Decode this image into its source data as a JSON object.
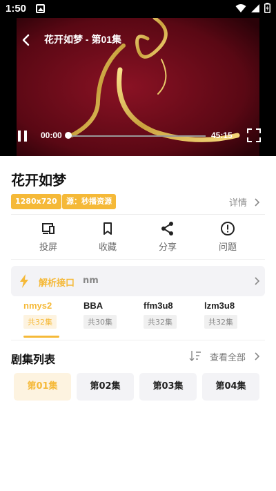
{
  "status_bar": {
    "time": "1:50",
    "icons": [
      "image-icon",
      "wifi-icon",
      "signal-icon",
      "battery-charging-icon"
    ]
  },
  "player": {
    "title": "花开如梦 - 第01集",
    "current_time": "00:00",
    "total_time": "45:15",
    "progress": 0,
    "state": "playing"
  },
  "info": {
    "title": "花开如梦",
    "badges": [
      "1280x720",
      "源：秒播资源"
    ],
    "details_label": "详情"
  },
  "actions": [
    {
      "label": "投屏",
      "icon": "cast-icon"
    },
    {
      "label": "收藏",
      "icon": "bookmark-icon"
    },
    {
      "label": "分享",
      "icon": "share-icon"
    },
    {
      "label": "问题",
      "icon": "alert-icon"
    }
  ],
  "source": {
    "label": "解析接口",
    "value": "nm",
    "tabs": [
      {
        "name": "nmys2",
        "count": "共32集"
      },
      {
        "name": "BBA",
        "count": "共30集"
      },
      {
        "name": "ffm3u8",
        "count": "共32集"
      },
      {
        "name": "lzm3u8",
        "count": "共32集"
      }
    ],
    "active_index": 0
  },
  "episodes": {
    "header": "剧集列表",
    "view_all": "查看全部",
    "items": [
      "第01集",
      "第02集",
      "第03集",
      "第04集"
    ],
    "active_index": 0
  },
  "colors": {
    "accent": "#f5b938",
    "accent_light": "#fdf3e0",
    "video_bg": "#6b0a18"
  }
}
